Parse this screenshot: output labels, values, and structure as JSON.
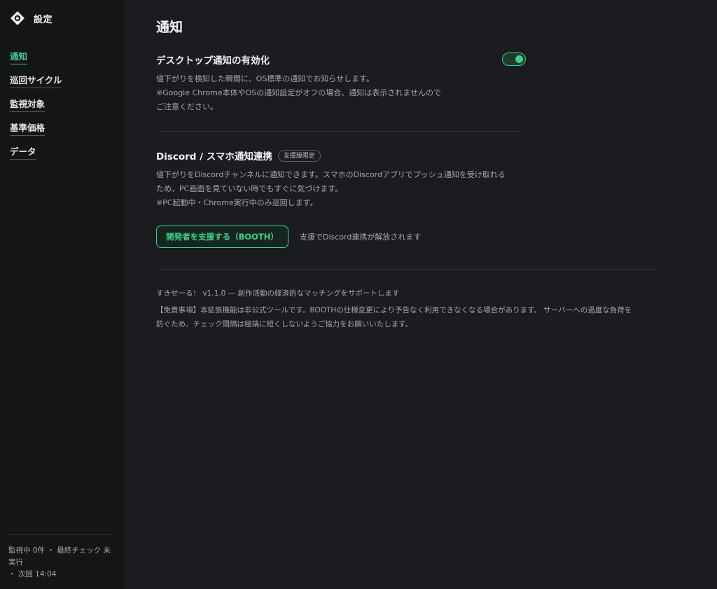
{
  "sidebar": {
    "title": "設定",
    "logo_icon": "tag-icon",
    "items": [
      {
        "label": "通知",
        "active": true
      },
      {
        "label": "巡回サイクル",
        "active": false
      },
      {
        "label": "監視対象",
        "active": false
      },
      {
        "label": "基準価格",
        "active": false
      },
      {
        "label": "データ",
        "active": false
      }
    ],
    "status_line1": "監視中 0件 ・ 最終チェック 未実行",
    "status_line2": "・ 次回 14:04"
  },
  "main": {
    "title": "通知",
    "desktop": {
      "title": "デスクトップ通知の有効化",
      "enabled": true,
      "desc1": "値下がりを検知した瞬間に、OS標準の通知でお知らせします。",
      "desc2": "※Google Chrome本体やOSの通知設定がオフの場合、通知は表示されませんので",
      "desc3": "ご注意ください。"
    },
    "discord": {
      "title": "Discord / スマホ通知連携",
      "badge": "支援版限定",
      "desc1": "値下がりをDiscordチャンネルに通知できます。スマホのDiscordアプリでプッシュ通知を受け取れる",
      "desc2": "ため、PC画面を見ていない時でもすぐに気づけます。",
      "desc3": "※PC起動中・Chrome実行中のみ巡回します。",
      "button_label": "開発者を支援する（BOOTH）",
      "button_note": "支援でDiscord連携が解放されます"
    },
    "footer": {
      "version_line": "すきせーる！ v1.1.0 — 創作活動の経済的なマッチングをサポートします",
      "disclaimer1": "【免責事項】本拡張機能は非公式ツールです。BOOTHの仕様変更により予告なく利用できなくなる場合があります。 サーバーへの過度な負荷を",
      "disclaimer2": "防ぐため、チェック間隔は極端に短くしないようご協力をお願いいたします。"
    }
  },
  "colors": {
    "accent": "#3ecf8e",
    "background": "#1b1c1f",
    "sidebar": "#141517"
  }
}
